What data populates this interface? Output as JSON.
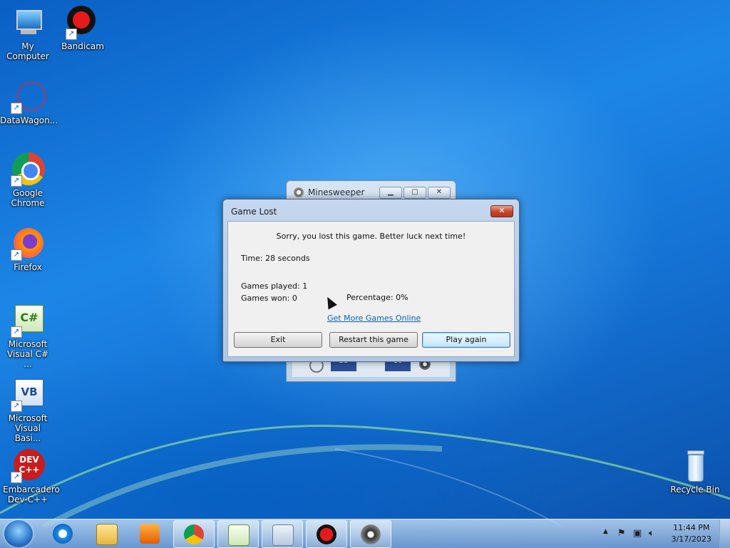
{
  "desktop": {
    "icons": [
      {
        "label": "My Computer",
        "icon": "computer-icon"
      },
      {
        "label": "Bandicam",
        "icon": "bandicam-icon"
      },
      {
        "label": "DataWagon...",
        "icon": "datawagon-icon"
      },
      {
        "label": "Google Chrome",
        "icon": "chrome-icon"
      },
      {
        "label": "Firefox",
        "icon": "firefox-icon"
      },
      {
        "label": "Microsoft Visual C# ...",
        "icon": "visual-csharp-icon"
      },
      {
        "label": "Microsoft Visual Basi...",
        "icon": "visual-basic-icon"
      },
      {
        "label": "Embarcadero Dev-C++",
        "icon": "devcpp-icon"
      },
      {
        "label": "Recycle Bin",
        "icon": "recycle-bin-icon"
      }
    ]
  },
  "minesweeper_window": {
    "title": "Minesweeper",
    "timer": "28",
    "mines": "10"
  },
  "dialog": {
    "title": "Game Lost",
    "close_label": "✕",
    "message": "Sorry, you lost this game. Better luck next time!",
    "time": "Time: 28 seconds",
    "games_played": "Games played: 1",
    "games_won": "Games won: 0",
    "percentage": "Percentage: 0%",
    "link": "Get More Games Online",
    "buttons": {
      "exit": "Exit",
      "restart": "Restart this game",
      "play_again": "Play again"
    }
  },
  "taskbar": {
    "items": [
      "internet-explorer-icon",
      "folder-icon",
      "media-player-icon",
      "chrome-icon",
      "visual-csharp-icon",
      "keyboard-app-icon",
      "bandicam-icon",
      "minesweeper-icon"
    ],
    "clock_time": "11:44 PM",
    "clock_date": "3/17/2023"
  },
  "colors": {
    "desktop": "#1c86e6",
    "dialog_frame": "#c4d7ee",
    "close_button": "#c7442a",
    "link": "#0a63b5"
  }
}
